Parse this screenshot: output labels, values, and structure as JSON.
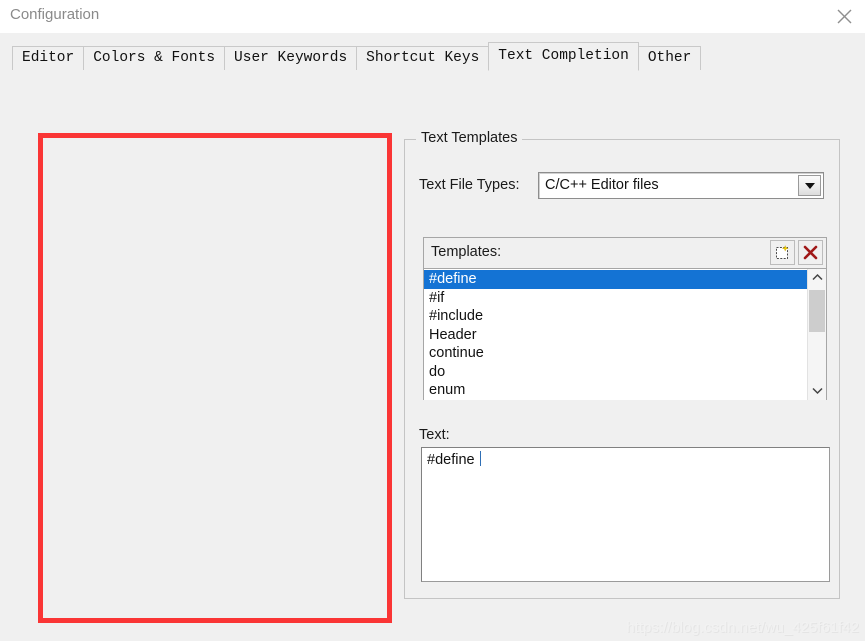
{
  "window": {
    "title": "Configuration",
    "close_icon": "close-icon"
  },
  "tabs": [
    {
      "label": "Editor",
      "selected": false
    },
    {
      "label": "Colors & Fonts",
      "selected": false
    },
    {
      "label": "User Keywords",
      "selected": false
    },
    {
      "label": "Shortcut Keys",
      "selected": false
    },
    {
      "label": "Text Completion",
      "selected": true
    },
    {
      "label": "Other",
      "selected": false
    }
  ],
  "groupbox": {
    "label": "Text Templates"
  },
  "file_types": {
    "label": "Text File Types:",
    "selected_value": "C/C++ Editor files",
    "dropdown_icon": "chevron-down-icon"
  },
  "templates": {
    "title": "Templates:",
    "new_icon": "new-template-icon",
    "delete_icon": "delete-red-x-icon",
    "items": [
      {
        "label": "#define",
        "selected": true
      },
      {
        "label": "#if",
        "selected": false
      },
      {
        "label": "#include",
        "selected": false
      },
      {
        "label": "Header",
        "selected": false
      },
      {
        "label": "continue",
        "selected": false
      },
      {
        "label": "do",
        "selected": false
      },
      {
        "label": "enum",
        "selected": false
      }
    ],
    "scroll_up_icon": "chevron-up-icon",
    "scroll_down_icon": "chevron-down-icon"
  },
  "text_editor": {
    "label": "Text:",
    "value": "#define "
  },
  "annotation": {
    "color": "#fa3535"
  },
  "watermark": {
    "text": "https://blog.csdn.net/wu_425f61f42"
  },
  "colors": {
    "selection_blue": "#1473d4",
    "face": "#f0f0f0",
    "annotation_red": "#fa3535"
  }
}
